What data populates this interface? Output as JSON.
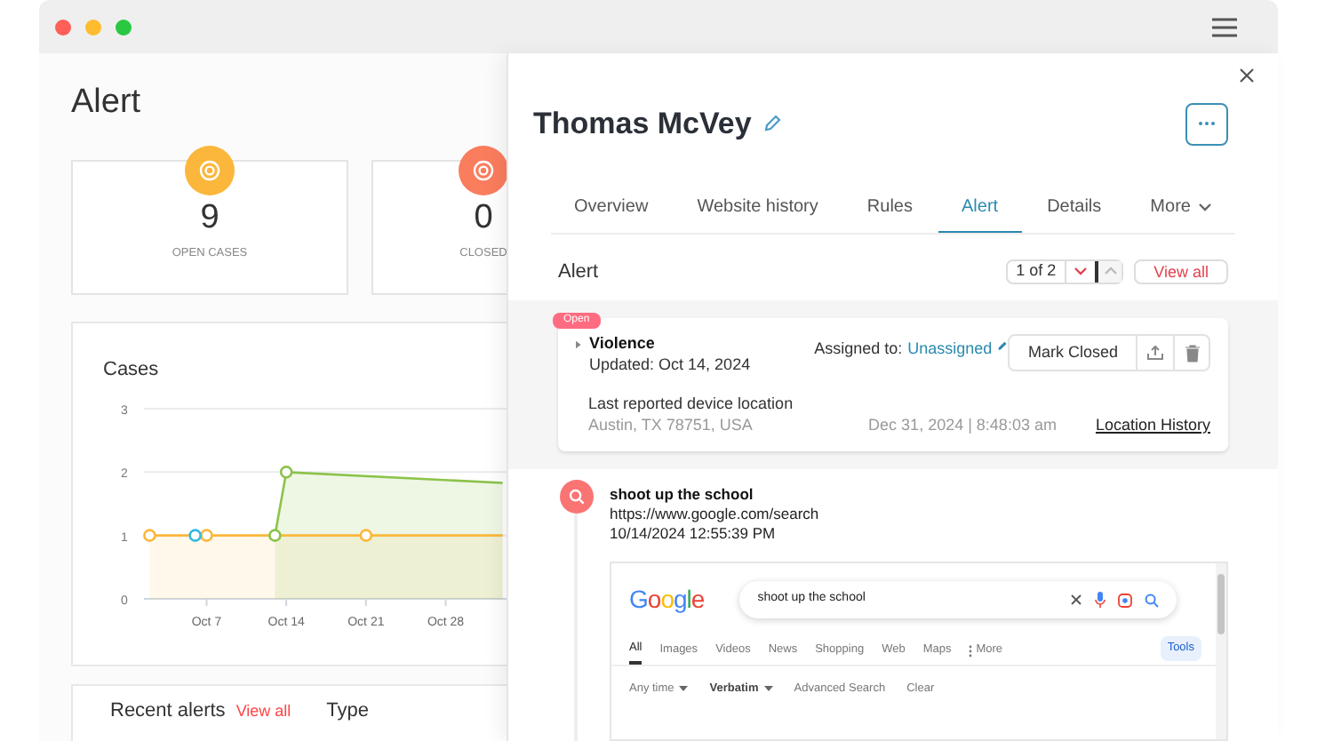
{
  "page": {
    "title": "Alert"
  },
  "stats": [
    {
      "value": "9",
      "label": "OPEN CASES",
      "color": "#fbb73c"
    },
    {
      "value": "0",
      "label": "CLOSED",
      "color": "#fa7d5e"
    }
  ],
  "cases_chart": {
    "title": "Cases",
    "chart_data": {
      "type": "line",
      "ylim": [
        0,
        3
      ],
      "yticks": [
        0,
        1,
        2,
        3
      ],
      "categories": [
        null,
        null,
        null,
        null,
        null,
        "Oct 7",
        null,
        null,
        null,
        null,
        null,
        null,
        "Oct 14",
        null,
        null,
        null,
        null,
        null,
        null,
        "Oct 21",
        null,
        null,
        null,
        null,
        null,
        null,
        "Oct 28",
        null,
        null,
        null,
        null,
        null
      ],
      "series": [
        {
          "color": "#fbb73c",
          "marker": "circle",
          "values": [
            1,
            null,
            null,
            null,
            null,
            1,
            null,
            null,
            null,
            null,
            null,
            null,
            null,
            null,
            null,
            null,
            null,
            null,
            null,
            1,
            null,
            null,
            null,
            null,
            null,
            null,
            null,
            null,
            null,
            null,
            null,
            1
          ]
        },
        {
          "color": "#8bc34a",
          "marker": "circle",
          "values": [
            null,
            null,
            null,
            null,
            null,
            null,
            null,
            null,
            null,
            null,
            null,
            1,
            2,
            null,
            null,
            null,
            null,
            null,
            null,
            null,
            null,
            null,
            null,
            null,
            null,
            null,
            null,
            null,
            null,
            null,
            null,
            1.83
          ]
        },
        {
          "color": "#35b8e0",
          "marker": "circle",
          "values": [
            null,
            null,
            null,
            null,
            1,
            null,
            null,
            null,
            null,
            null,
            null,
            null,
            null,
            null,
            null,
            null,
            null,
            null,
            null,
            null,
            null,
            null,
            null,
            null,
            null,
            null,
            null,
            null,
            null,
            null,
            null,
            null
          ]
        }
      ]
    }
  },
  "recent_alerts": {
    "title": "Recent alerts",
    "link": "View all",
    "column_1": "Type"
  },
  "panel": {
    "name": "Thomas McVey",
    "tabs": [
      {
        "label": "Overview",
        "selected": false,
        "kind": "tab"
      },
      {
        "label": "Website history",
        "selected": false,
        "kind": "tab"
      },
      {
        "label": "Rules",
        "selected": false,
        "kind": "tab"
      },
      {
        "label": "Alert",
        "selected": true,
        "kind": "tab"
      },
      {
        "label": "Details",
        "selected": false,
        "kind": "tab"
      },
      {
        "label": "More",
        "selected": false,
        "kind": "menu"
      }
    ],
    "section_title": "Alert",
    "pager": "1 of 2",
    "view_all": "View all",
    "alert": {
      "status": "Open",
      "title": "Violence",
      "updated": "Updated: Oct 14, 2024",
      "assigned_label": "Assigned to:",
      "assignee": "Unassigned",
      "action": "Mark Closed",
      "expanded": false,
      "location_label": "Last reported device location",
      "location": "Austin, TX 78751, USA",
      "timestamp": "Dec 31, 2024 | 8:48:03 am",
      "location_link": "Location History"
    },
    "event": {
      "query": "shoot up the school",
      "url": "https://www.google.com/search",
      "time": "10/14/2024 12:55:39 PM",
      "screenshot": {
        "logo": "Google",
        "query": "shoot up the school",
        "tabs": [
          {
            "label": "All",
            "selected": true,
            "kind": "tab"
          },
          {
            "label": "Images",
            "selected": false,
            "kind": "tab"
          },
          {
            "label": "Videos",
            "selected": false,
            "kind": "tab"
          },
          {
            "label": "News",
            "selected": false,
            "kind": "tab"
          },
          {
            "label": "Shopping",
            "selected": false,
            "kind": "tab"
          },
          {
            "label": "Web",
            "selected": false,
            "kind": "tab"
          },
          {
            "label": "Maps",
            "selected": false,
            "kind": "tab"
          },
          {
            "label": "More",
            "selected": false,
            "kind": "menu"
          }
        ],
        "tools": "Tools",
        "filters": [
          {
            "label": "Any time",
            "kind": "dropdown",
            "selected": false
          },
          {
            "label": "Verbatim",
            "kind": "dropdown",
            "selected": true
          },
          {
            "label": "Advanced Search",
            "kind": "link",
            "selected": false
          },
          {
            "label": "Clear",
            "kind": "link",
            "selected": false
          }
        ]
      }
    }
  }
}
